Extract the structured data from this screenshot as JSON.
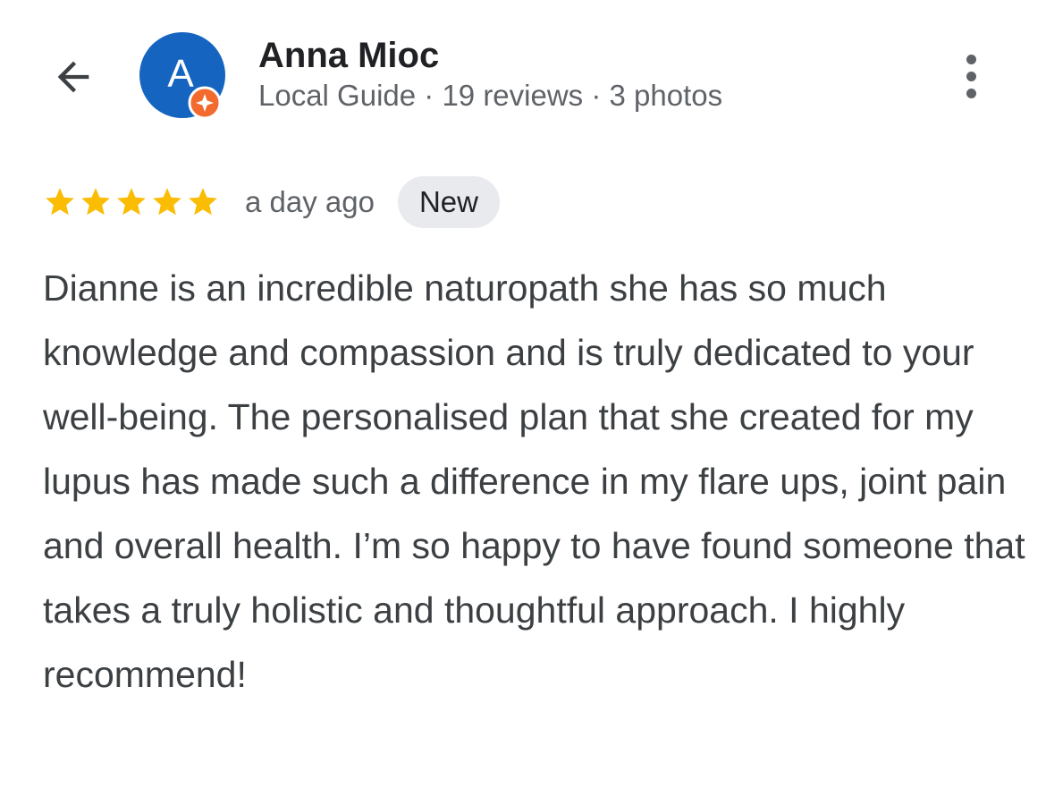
{
  "author": {
    "name": "Anna Mioc",
    "avatar_letter": "A",
    "meta": "Local Guide · 19 reviews · 3 photos"
  },
  "review": {
    "rating": 5,
    "rating_max": 5,
    "date": "a day ago",
    "badge": "New",
    "text": "Dianne is an incredible naturopath she has so much knowledge and compassion and is truly dedicated to your well-being. The personalised plan that she created for my lupus has made such a difference in my flare ups, joint pain and overall health. I’m so happy to have found someone that takes a truly holistic and thoughtful approach. I highly recommend!"
  },
  "icons": {
    "back": "arrow-back-icon",
    "more": "more-vertical-icon",
    "badge": "local-guide-badge-icon",
    "star": "star-icon"
  },
  "colors": {
    "avatar_bg": "#1565c0",
    "guide_badge": "#f26a2e",
    "star": "#fbbc04",
    "new_badge_bg": "#e8eaed",
    "text": "#3c4043",
    "secondary_text": "#5f6368"
  }
}
